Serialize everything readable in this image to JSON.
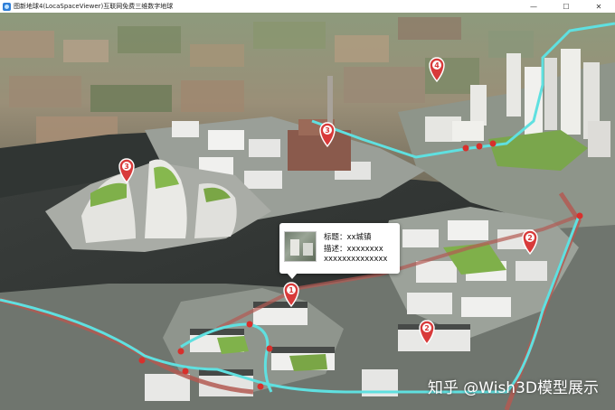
{
  "window": {
    "title": "图新地球4(LocaSpaceViewer)互联网免费三维数字地球",
    "controls": {
      "minimize": "—",
      "maximize": "☐",
      "close": "✕"
    }
  },
  "popup": {
    "title_line": "标题：xx城镇",
    "desc_line": "描述：xxxxxxxx",
    "desc_line2": "xxxxxxxxxxxxxx"
  },
  "markers": [
    {
      "label": "1"
    },
    {
      "label": "2"
    },
    {
      "label": "2"
    },
    {
      "label": "3"
    },
    {
      "label": "3"
    },
    {
      "label": "4"
    }
  ],
  "watermark": "知乎 @Wish3D模型展示",
  "colors": {
    "route": "#5fe0e0",
    "route_node": "#d8302c",
    "marker": "#d83a3a",
    "road": "#b35a52"
  }
}
